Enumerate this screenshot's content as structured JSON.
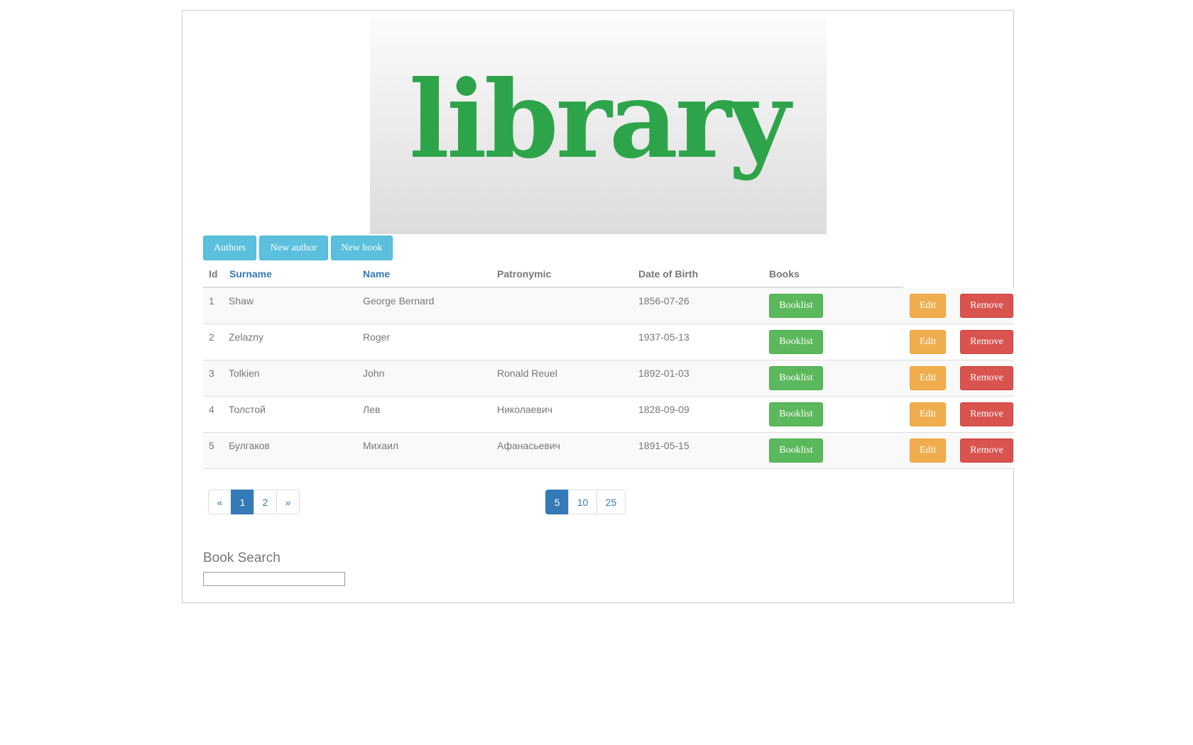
{
  "logo": {
    "text": "library",
    "color": "#2ea44a"
  },
  "toolbar": {
    "authors_label": "Authors",
    "new_author_label": "New author",
    "new_book_label": "New book"
  },
  "table": {
    "headers": {
      "id": "Id",
      "surname": "Surname",
      "name": "Name",
      "patronymic": "Patronymic",
      "dob": "Date of Birth",
      "books": "Books"
    },
    "rows": [
      {
        "id": "1",
        "surname": "Shaw",
        "name": "George Bernard",
        "patronymic": "",
        "dob": "1856-07-26"
      },
      {
        "id": "2",
        "surname": "Zelazny",
        "name": "Roger",
        "patronymic": "",
        "dob": "1937-05-13"
      },
      {
        "id": "3",
        "surname": "Tolkien",
        "name": "John",
        "patronymic": "Ronald Reuel",
        "dob": "1892-01-03"
      },
      {
        "id": "4",
        "surname": "Толстой",
        "name": "Лев",
        "patronymic": "Николаевич",
        "dob": "1828-09-09"
      },
      {
        "id": "5",
        "surname": "Булгаков",
        "name": "Михаил",
        "patronymic": "Афанасьевич",
        "dob": "1891-05-15"
      }
    ],
    "actions": {
      "booklist": "Booklist",
      "edit": "Edit",
      "remove": "Remove"
    }
  },
  "pagination": {
    "prev": "«",
    "pages": [
      "1",
      "2"
    ],
    "active_page": "1",
    "next": "»"
  },
  "page_size": {
    "options": [
      "5",
      "10",
      "25"
    ],
    "active": "5"
  },
  "search": {
    "title": "Book Search",
    "value": ""
  },
  "colors": {
    "info": "#5bc0de",
    "success": "#5cb85c",
    "warning": "#f0ad4e",
    "danger": "#d9534f",
    "primary": "#337ab7"
  }
}
